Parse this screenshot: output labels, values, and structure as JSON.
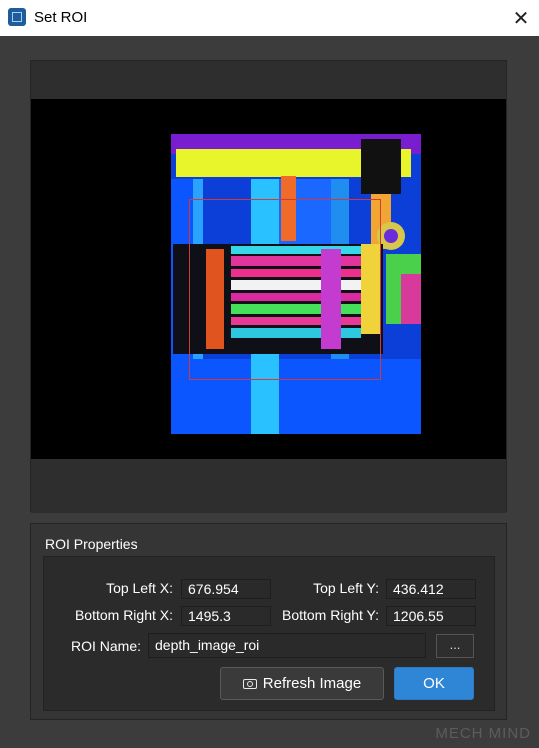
{
  "window": {
    "title": "Set ROI",
    "close_glyph": "✕"
  },
  "viewer": {
    "roi_color": "#d03a3a"
  },
  "roi_properties": {
    "section_title": "ROI Properties",
    "top_left_x_label": "Top Left X:",
    "top_left_x_value": "676.954",
    "top_left_y_label": "Top Left Y:",
    "top_left_y_value": "436.412",
    "bottom_right_x_label": "Bottom Right X:",
    "bottom_right_x_value": "1495.3",
    "bottom_right_y_label": "Bottom Right Y:",
    "bottom_right_y_value": "1206.55",
    "roi_name_label": "ROI Name:",
    "roi_name_value": "depth_image_roi",
    "browse_label": "..."
  },
  "buttons": {
    "refresh_label": "Refresh Image",
    "ok_label": "OK"
  },
  "colors": {
    "accent": "#2f86d6",
    "background": "#3c3c3c"
  },
  "watermark": "MECH MIND"
}
